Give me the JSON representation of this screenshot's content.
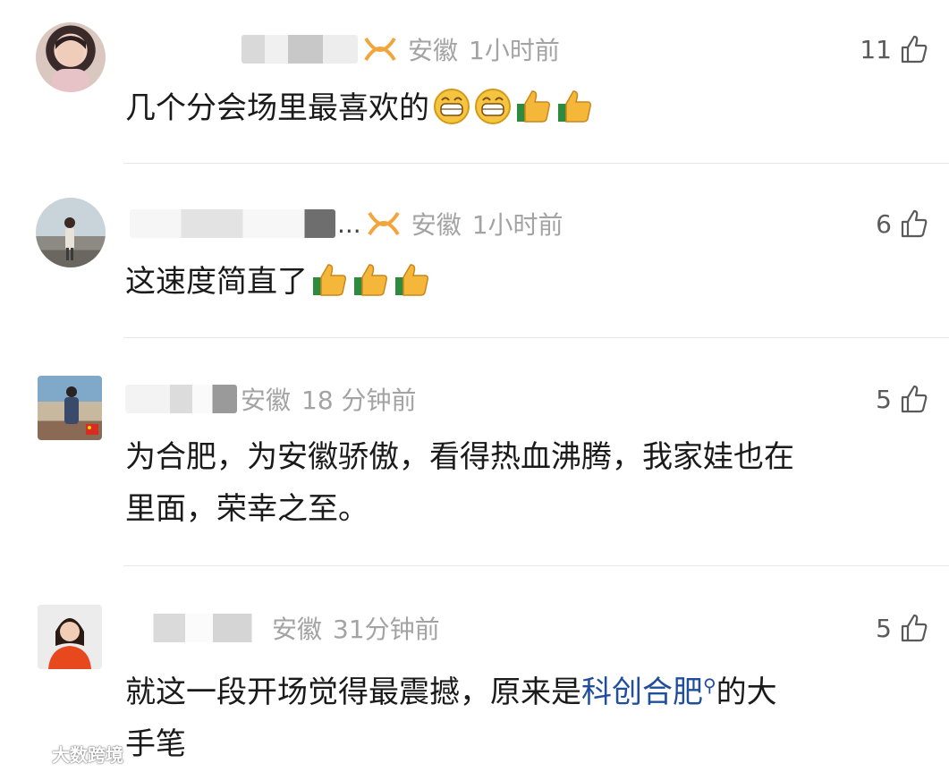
{
  "comments": [
    {
      "location": "安徽",
      "time": "1小时前",
      "likes": "11",
      "text": "几个分会场里最喜欢的",
      "emojis": [
        "grin",
        "grin",
        "thumbs-up",
        "thumbs-up"
      ],
      "has_ellipsis": false
    },
    {
      "ellipsis": "...",
      "location": "安徽",
      "time": "1小时前",
      "likes": "6",
      "text": "这速度简直了",
      "emojis": [
        "thumbs-up",
        "thumbs-up",
        "thumbs-up"
      ]
    },
    {
      "location": "安徽",
      "time": "18 分钟前",
      "likes": "5",
      "text_line1": "为合肥，为安徽骄傲，看得热血沸腾，我家娃也在",
      "text_line2": "里面，荣幸之至。"
    },
    {
      "location": "安徽",
      "time": "31分钟前",
      "likes": "5",
      "text_before_link": "就这一段开场觉得最震撼，原来是",
      "link_text": "科创合肥",
      "text_after_link": "的大",
      "text_line2": "手笔"
    }
  ],
  "watermark": "大数跨境",
  "colors": {
    "meta": "#a3a3a3",
    "link": "#1f4e9c",
    "divider": "#e8e8e8"
  }
}
